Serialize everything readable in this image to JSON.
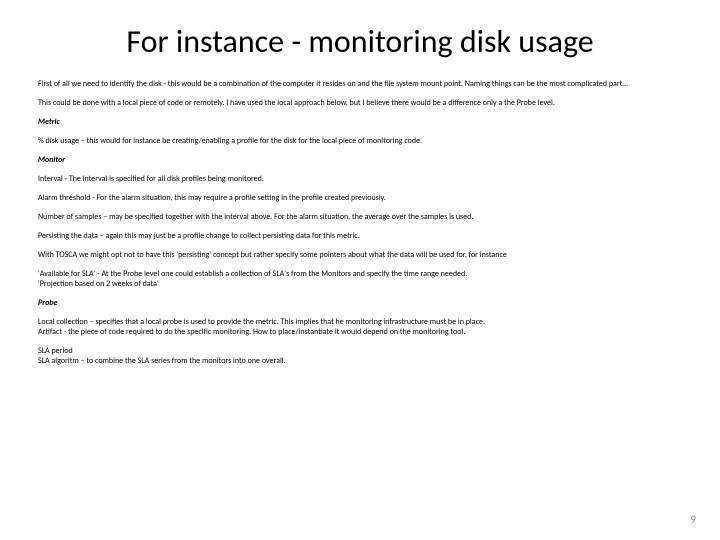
{
  "title": "For instance - monitoring disk usage",
  "paragraphs": [
    {
      "text": "First of all we need to identify the disk - this would be a combination of the computer it resides on and the file system mount point. Naming things can be the most complicated part…"
    },
    {
      "text": "This could be done with a local piece of code or remotely. I have used the local approach below, but I believe there would be a difference only a the Probe level."
    },
    {
      "text": "Metric",
      "style": "bi"
    },
    {
      "text": "% disk usage – this would for instance be creating/enabling a profile for the disk for the local piece of monitoring code."
    },
    {
      "text": "Monitor",
      "style": "bi"
    },
    {
      "text": "Interval - The interval is specified for all disk profiles being monitored."
    },
    {
      "text": " Alarm threshold - For the alarm situation, this may require a profile setting in the profile created previously."
    },
    {
      "text": "Number of samples – may be specified together with the interval above. For the alarm situation, the average over the samples is used."
    },
    {
      "text": "Persisting the data – again this may just be a profile change to collect persisting data for this metric."
    },
    {
      "text": "With TOSCA we might opt not to have this 'persisting' concept but rather specify some pointers about what the data will be used for, for instance"
    },
    {
      "text": "'Available for SLA' - At the Probe level one could establish a collection of SLA's from the Monitors and specify the time range needed.\n'Projection based on 2 weeks of data'"
    },
    {
      "text": "Probe",
      "style": "bi"
    },
    {
      "text": "Local collection – specifies that a local probe is used to provide the metric. This implies that he monitoring infrastructure must be in place.\nArtifact - the piece of code required to do the specific monitoring. How to place/instantiate it would depend on the monitoring tool."
    },
    {
      "text": "SLA period\nSLA algoritm – to combine the SLA series from the monitors into one overall."
    }
  ],
  "pageNumber": "9"
}
